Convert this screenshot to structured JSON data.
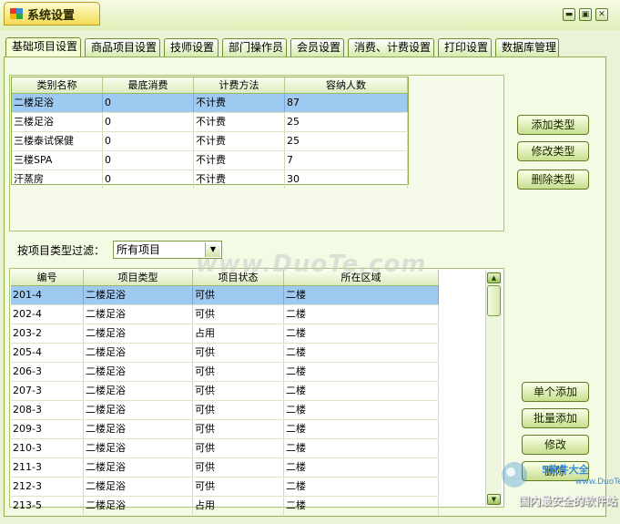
{
  "window": {
    "title": "系统设置",
    "controls": {
      "minimize": "▬",
      "restore": "▣",
      "close": "✕"
    }
  },
  "tabs": [
    {
      "label": "基础项目设置",
      "active": true
    },
    {
      "label": "商品项目设置",
      "active": false
    },
    {
      "label": "技师设置",
      "active": false
    },
    {
      "label": "部门操作员",
      "active": false
    },
    {
      "label": "会员设置",
      "active": false
    },
    {
      "label": "消费、计费设置",
      "active": false
    },
    {
      "label": "打印设置",
      "active": false
    },
    {
      "label": "数据库管理",
      "active": false
    }
  ],
  "type_table": {
    "columns": [
      "类别名称",
      "最底消费",
      "计费方法",
      "容纳人数"
    ],
    "rows": [
      [
        "二楼足浴",
        "0",
        "不计费",
        "87"
      ],
      [
        "三楼足浴",
        "0",
        "不计费",
        "25"
      ],
      [
        "三楼泰试保健",
        "0",
        "不计费",
        "25"
      ],
      [
        "三楼SPA",
        "0",
        "不计费",
        "7"
      ],
      [
        "汗蒸房",
        "0",
        "不计费",
        "30"
      ]
    ],
    "selected_row": 0
  },
  "type_buttons": {
    "add": "添加类型",
    "edit": "修改类型",
    "delete": "删除类型"
  },
  "filter": {
    "label": "按项目类型过滤：",
    "value": "所有项目"
  },
  "item_table": {
    "columns": [
      "编号",
      "项目类型",
      "项目状态",
      "所在区域"
    ],
    "rows": [
      [
        "201-4",
        "二楼足浴",
        "可供",
        "二楼"
      ],
      [
        "202-4",
        "二楼足浴",
        "可供",
        "二楼"
      ],
      [
        "203-2",
        "二楼足浴",
        "占用",
        "二楼"
      ],
      [
        "205-4",
        "二楼足浴",
        "可供",
        "二楼"
      ],
      [
        "206-3",
        "二楼足浴",
        "可供",
        "二楼"
      ],
      [
        "207-3",
        "二楼足浴",
        "可供",
        "二楼"
      ],
      [
        "208-3",
        "二楼足浴",
        "可供",
        "二楼"
      ],
      [
        "209-3",
        "二楼足浴",
        "可供",
        "二楼"
      ],
      [
        "210-3",
        "二楼足浴",
        "可供",
        "二楼"
      ],
      [
        "211-3",
        "二楼足浴",
        "可供",
        "二楼"
      ],
      [
        "212-3",
        "二楼足浴",
        "可供",
        "二楼"
      ],
      [
        "213-5",
        "二楼足浴",
        "占用",
        "二楼"
      ]
    ],
    "selected_row": 0
  },
  "item_buttons": {
    "single_add": "单个添加",
    "batch_add": "批量添加",
    "edit": "修改",
    "delete": "删除"
  },
  "scrollbar": {
    "up": "▲",
    "down": "▼"
  },
  "watermark": {
    "text": "www.DuoTe.com",
    "brand": "5软件大全",
    "url": "www.DuoTe.com",
    "slogan": "国内最安全的软件站"
  },
  "colors": {
    "frame": "#8fb04a",
    "selected_row": "#9ec9f0",
    "title_tab": "#f4dc55"
  }
}
